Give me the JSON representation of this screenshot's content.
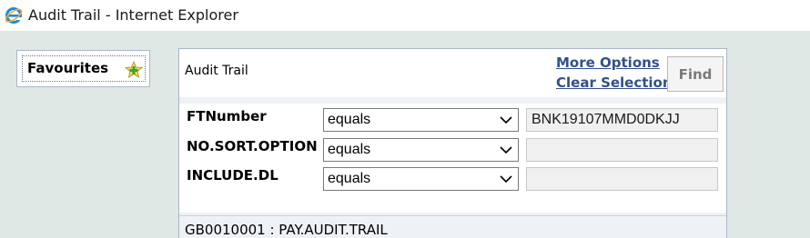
{
  "window": {
    "title": "Audit Trail - Internet Explorer",
    "icon": "internet-explorer-icon"
  },
  "favourites": {
    "label": "Favourites",
    "icon": "add-favourite-icon"
  },
  "panel": {
    "title": "Audit Trail",
    "more_options": "More Options",
    "clear_selection": "Clear Selection",
    "find_label": "Find",
    "criteria": [
      {
        "field": "FTNumber",
        "operator": "equals",
        "value": "BNK19107MMD0DKJJ"
      },
      {
        "field": "NO.SORT.OPTION",
        "operator": "equals",
        "value": ""
      },
      {
        "field": "INCLUDE.DL",
        "operator": "equals",
        "value": ""
      }
    ],
    "footer": "GB0010001 : PAY.AUDIT.TRAIL"
  },
  "colors": {
    "background": "#dfe8e5",
    "link": "#33508c",
    "panel_border": "#a9b7c6"
  }
}
